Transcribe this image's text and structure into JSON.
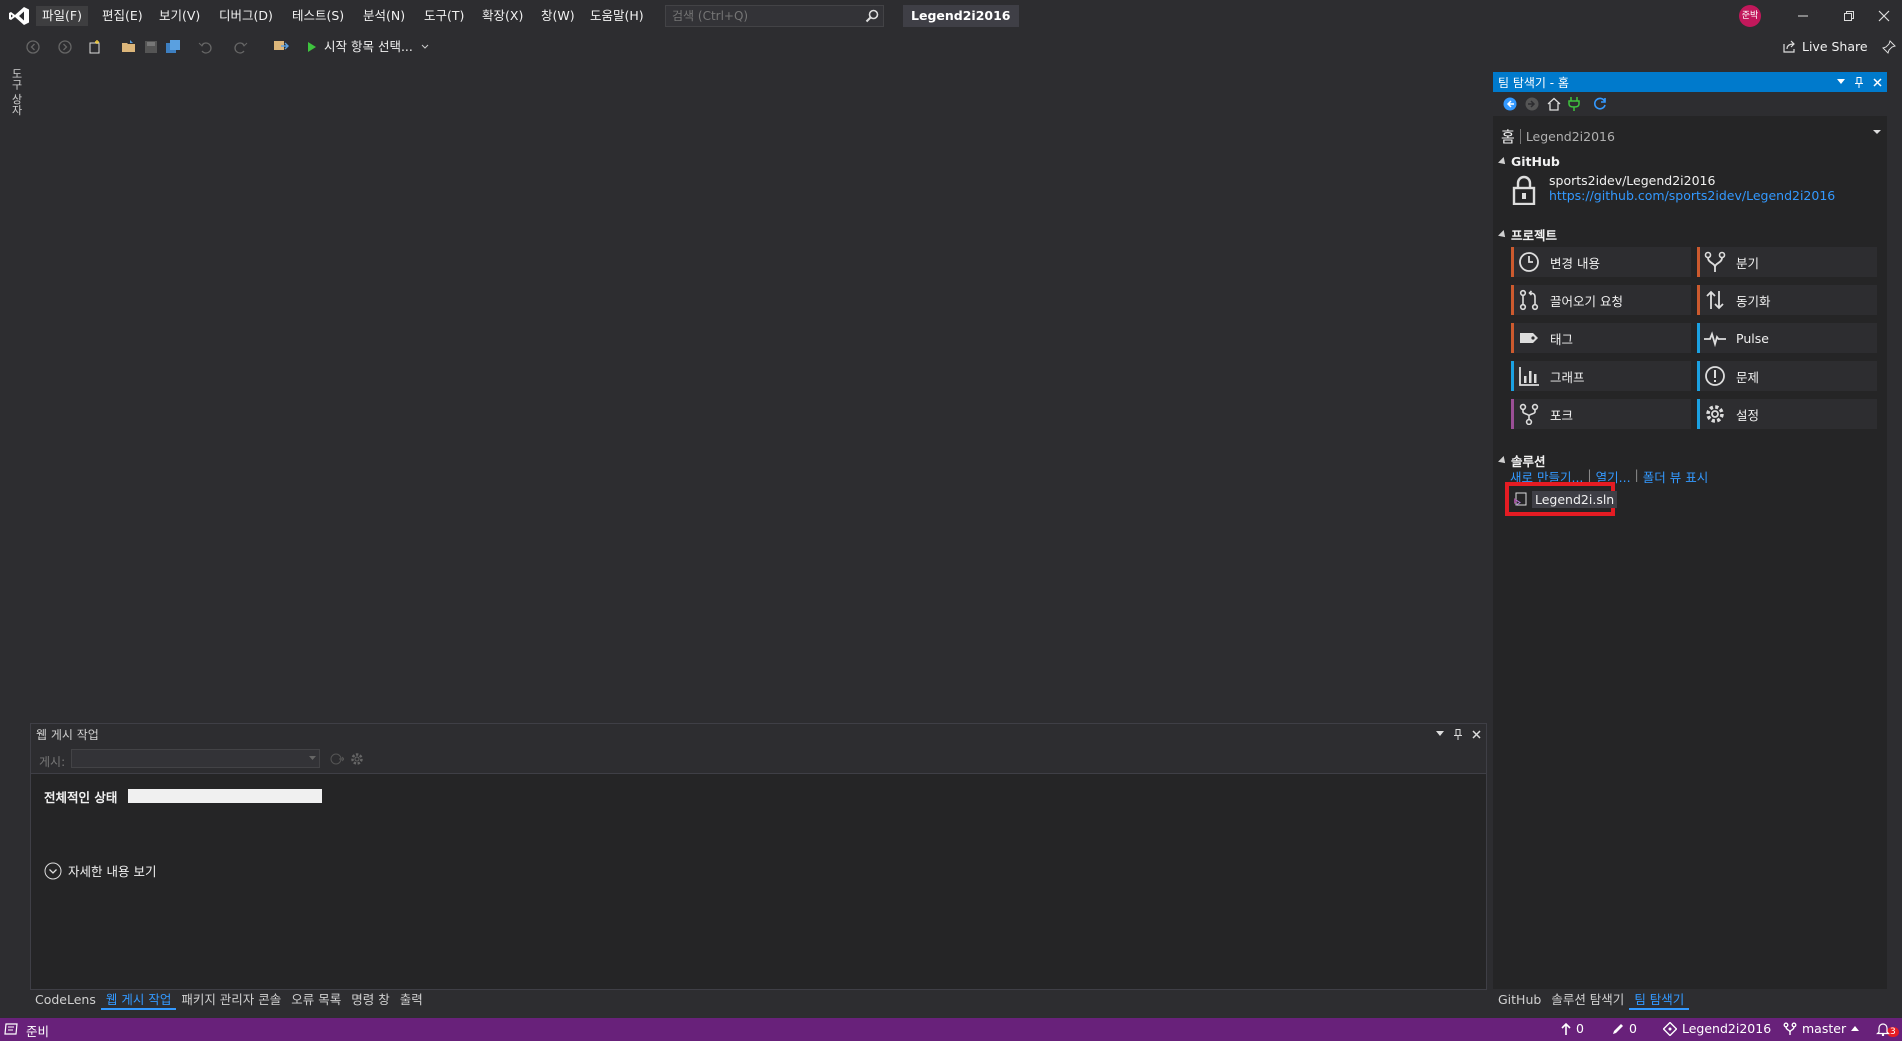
{
  "menu": {
    "items": [
      "파일(F)",
      "편집(E)",
      "보기(V)",
      "디버그(D)",
      "테스트(S)",
      "분석(N)",
      "도구(T)",
      "확장(X)",
      "창(W)",
      "도움말(H)"
    ]
  },
  "search": {
    "placeholder": "검색 (Ctrl+Q)"
  },
  "solution_name": "Legend2i2016",
  "user": {
    "initials": "준박"
  },
  "toolbar": {
    "start_item": "시작 항목 선택...",
    "live_share": "Live Share"
  },
  "left_tab": {
    "label": "도구 상자"
  },
  "bottom_panel": {
    "title": "웹 게시 작업",
    "publish_label": "게시:",
    "overall_label": "전체적인 상태",
    "progress": 1.0,
    "details_label": "자세한 내용 보기"
  },
  "bottom_tabs": [
    "CodeLens",
    "웹 게시 작업",
    "패키지 관리자 콘솔",
    "오류 목록",
    "명령 창",
    "출력"
  ],
  "bottom_tabs_active": 1,
  "team_explorer": {
    "title": "팀 탐색기 - 홈",
    "page_title": "홈",
    "page_subtitle": "Legend2i2016",
    "github": {
      "section": "GitHub",
      "repo": "sports2idev/Legend2i2016",
      "url": "https://github.com/sports2idev/Legend2i2016"
    },
    "project": {
      "section": "프로젝트",
      "tiles": [
        {
          "label": "변경 내용",
          "icon": "clock-icon",
          "accent": "#cc5a2e"
        },
        {
          "label": "분기",
          "icon": "branch-icon",
          "accent": "#cc5a2e"
        },
        {
          "label": "끌어오기 요청",
          "icon": "pull-request-icon",
          "accent": "#cc5a2e"
        },
        {
          "label": "동기화",
          "icon": "sync-icon",
          "accent": "#cc5a2e"
        },
        {
          "label": "태그",
          "icon": "tag-icon",
          "accent": "#cc5a2e"
        },
        {
          "label": "Pulse",
          "icon": "pulse-icon",
          "accent": "#1ba1e2"
        },
        {
          "label": "그래프",
          "icon": "graph-icon",
          "accent": "#1ba1e2"
        },
        {
          "label": "문제",
          "icon": "issue-icon",
          "accent": "#1ba1e2"
        },
        {
          "label": "포크",
          "icon": "fork-icon",
          "accent": "#9b4f96"
        },
        {
          "label": "설정",
          "icon": "gear-icon",
          "accent": "#1ba1e2"
        }
      ]
    },
    "solutions": {
      "section": "솔루션",
      "links": [
        "새로 만들기...",
        "열기...",
        "폴더 뷰 표시"
      ],
      "item": "Legend2i.sln"
    }
  },
  "right_tabs": [
    "GitHub",
    "솔루션 탐색기",
    "팀 탐색기"
  ],
  "right_tabs_active": 2,
  "status": {
    "text": "준비",
    "up_count": "0",
    "edit_count": "0",
    "repo": "Legend2i2016",
    "branch": "master",
    "notifications": "3"
  },
  "colors": {
    "accent": "#007acc",
    "statusbar": "#68217a",
    "highlight_box": "#e51c23"
  }
}
